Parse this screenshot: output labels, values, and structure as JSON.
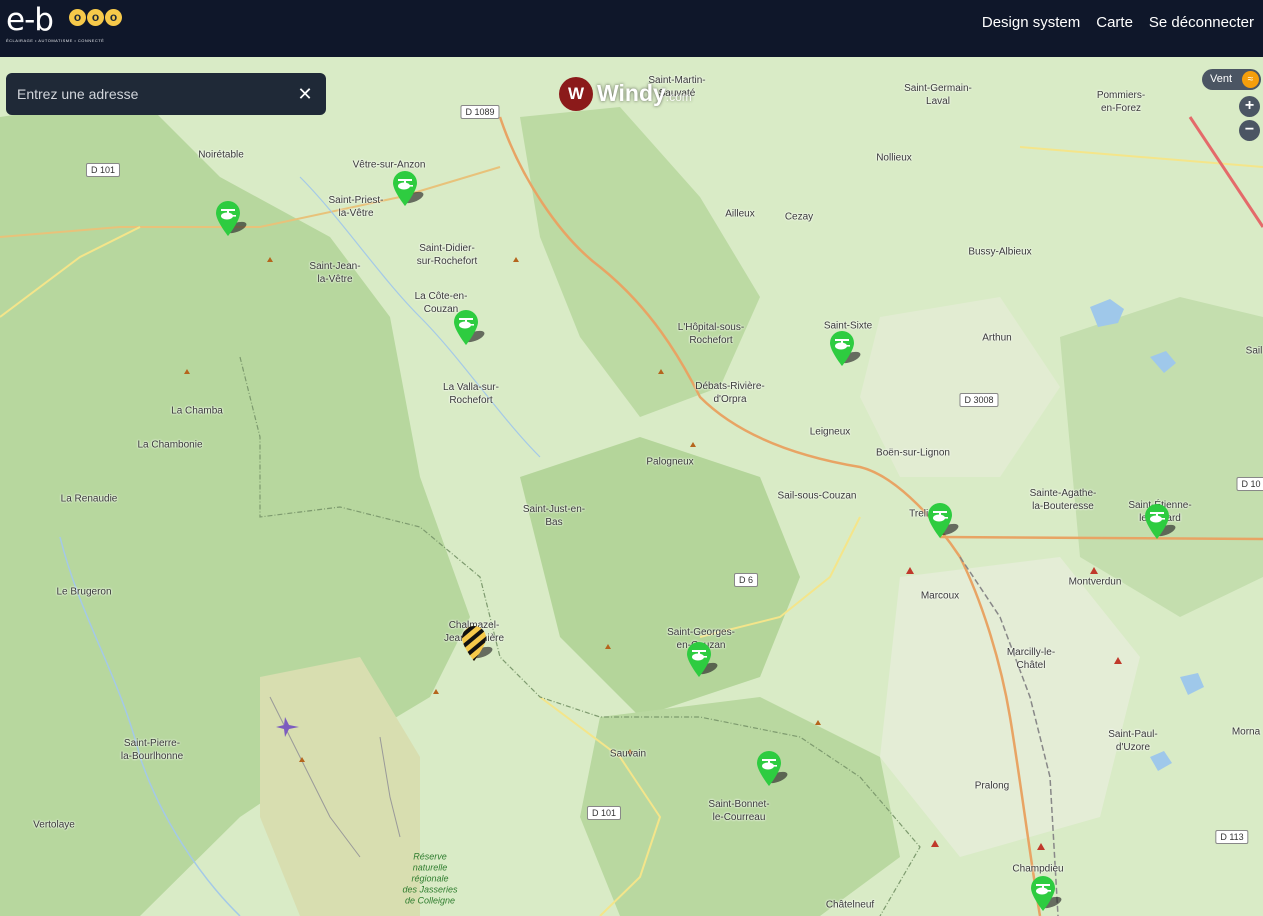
{
  "app": {
    "logo_text": "e-b",
    "logo_dots": [
      "o",
      "o",
      "o"
    ],
    "logo_tagline": "ÉCLAIRAGE • AUTOMATISME • CONNECTÉ",
    "brand_color": "#f6c94a",
    "nav_bg": "#0f172a"
  },
  "nav": {
    "design_system": "Design system",
    "carte": "Carte",
    "logout": "Se déconnecter"
  },
  "search": {
    "placeholder": "Entrez une adresse",
    "value": "",
    "clear_icon": "close-icon"
  },
  "windy": {
    "name": "Windy",
    "suffix": ".com",
    "icon": "windy-logo-icon"
  },
  "wind_toggle": {
    "label": "Vent",
    "icon": "wind-icon",
    "color": "#f59e0b"
  },
  "zoom": {
    "in_label": "+",
    "out_label": "−"
  },
  "map": {
    "places": [
      "Saint-Martin-\nSauvaté",
      "Saint-Germain-\nLaval",
      "Pommiers-\nen-Forez",
      "Noirétable",
      "Vêtre-sur-Anzon",
      "Saint-Priest-\nla-Vêtre",
      "Nollieux",
      "Ailleux",
      "Cezay",
      "Saint-Didier-\nsur-Rochefort",
      "Bussy-Albieux",
      "Saint-Jean-\nla-Vêtre",
      "La Côte-en-\nCouzan",
      "L'Hôpital-sous-\nRochefort",
      "Saint-Sixte",
      "Arthun",
      "La Valla-sur-\nRochefort",
      "Débats-Rivière-\nd'Orpra",
      "La Chamba",
      "Leigneux",
      "La Chambonie",
      "Boën-sur-Lignon",
      "Palogneux",
      "Sail-sous-Couzan",
      "La Renaudie",
      "Sainte-Agathe-\nla-Bouteresse",
      "Saint-Étienne-\nle-Molard",
      "Trelins",
      "Saint-Just-en-\nBas",
      "Montverdun",
      "Le Brugeron",
      "Marcoux",
      "Chalmazel-\nJeansagnière",
      "Saint-Georges-\nen-Couzan",
      "Marcilly-le-\nChâtel",
      "Saint-Pierre-\nla-Bourlhonne",
      "Sauvain",
      "Saint-Paul-\nd'Uzore",
      "Pralong",
      "Saint-Bonnet-\nle-Courreau",
      "Vertolaye",
      "Champdieu",
      "Châtelneuf",
      "Sail",
      "Morna"
    ],
    "roads": [
      "D 1089",
      "D 101",
      "D 3008",
      "D 10",
      "D 6",
      "D 101",
      "D 113"
    ],
    "reserve_label": "Réserve\nnaturelle\nrégionale\ndes Jasseries\nde Colleigne",
    "marker_icon": "helicopter-marker-icon",
    "marker_color": "#2ecc40",
    "selected_marker_icon": "selected-marker-icon",
    "marker_count": 12
  }
}
